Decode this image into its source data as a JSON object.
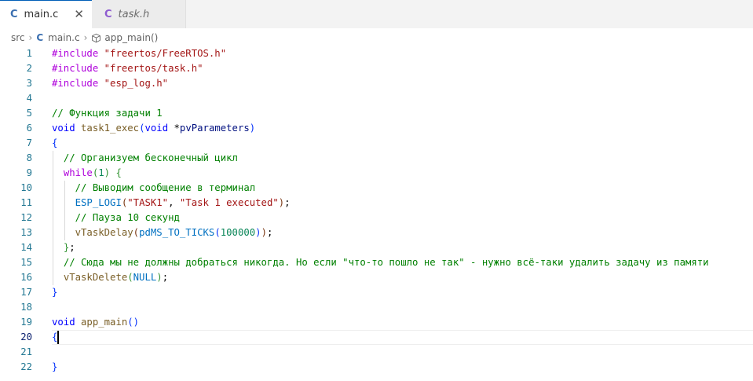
{
  "tabs": [
    {
      "icon": "C",
      "label": "main.c",
      "active": true
    },
    {
      "icon": "C",
      "label": "task.h",
      "active": false
    }
  ],
  "breadcrumb": {
    "folder": "src",
    "file": "main.c",
    "symbol": "app_main()"
  },
  "editor": {
    "current_line": 20,
    "line_numbers": [
      "1",
      "2",
      "3",
      "4",
      "5",
      "6",
      "7",
      "8",
      "9",
      "10",
      "11",
      "12",
      "13",
      "14",
      "15",
      "16",
      "17",
      "18",
      "19",
      "20",
      "21",
      "22"
    ],
    "lines": [
      [
        {
          "t": "#include",
          "c": "pp"
        },
        {
          "t": " ",
          "c": "pl"
        },
        {
          "t": "\"freertos/FreeRTOS.h\"",
          "c": "str"
        }
      ],
      [
        {
          "t": "#include",
          "c": "pp"
        },
        {
          "t": " ",
          "c": "pl"
        },
        {
          "t": "\"freertos/task.h\"",
          "c": "str"
        }
      ],
      [
        {
          "t": "#include",
          "c": "pp"
        },
        {
          "t": " ",
          "c": "pl"
        },
        {
          "t": "\"esp_log.h\"",
          "c": "str"
        }
      ],
      [],
      [
        {
          "t": "// Функция задачи 1",
          "c": "cm"
        }
      ],
      [
        {
          "t": "void",
          "c": "kw"
        },
        {
          "t": " ",
          "c": "pl"
        },
        {
          "t": "task1_exec",
          "c": "fn"
        },
        {
          "t": "(",
          "c": "br1"
        },
        {
          "t": "void",
          "c": "kw"
        },
        {
          "t": " *",
          "c": "pl"
        },
        {
          "t": "pvParameters",
          "c": "id"
        },
        {
          "t": ")",
          "c": "br1"
        }
      ],
      [
        {
          "t": "{",
          "c": "br1"
        }
      ],
      [
        {
          "t": "  ",
          "c": "pl"
        },
        {
          "t": "// Организуем бесконечный цикл",
          "c": "cm"
        }
      ],
      [
        {
          "t": "  ",
          "c": "pl"
        },
        {
          "t": "while",
          "c": "pp"
        },
        {
          "t": "(",
          "c": "br2"
        },
        {
          "t": "1",
          "c": "nm"
        },
        {
          "t": ")",
          "c": "br2"
        },
        {
          "t": " ",
          "c": "pl"
        },
        {
          "t": "{",
          "c": "br2"
        }
      ],
      [
        {
          "t": "    ",
          "c": "pl"
        },
        {
          "t": "// Выводим сообщение в терминал",
          "c": "cm"
        }
      ],
      [
        {
          "t": "    ",
          "c": "pl"
        },
        {
          "t": "ESP_LOGI",
          "c": "mc"
        },
        {
          "t": "(",
          "c": "br3"
        },
        {
          "t": "\"TASK1\"",
          "c": "str"
        },
        {
          "t": ", ",
          "c": "pl"
        },
        {
          "t": "\"Task 1 executed\"",
          "c": "str"
        },
        {
          "t": ")",
          "c": "br3"
        },
        {
          "t": ";",
          "c": "pl"
        }
      ],
      [
        {
          "t": "    ",
          "c": "pl"
        },
        {
          "t": "// Пауза 10 секунд",
          "c": "cm"
        }
      ],
      [
        {
          "t": "    ",
          "c": "pl"
        },
        {
          "t": "vTaskDelay",
          "c": "fn"
        },
        {
          "t": "(",
          "c": "br3"
        },
        {
          "t": "pdMS_TO_TICKS",
          "c": "mc"
        },
        {
          "t": "(",
          "c": "br1"
        },
        {
          "t": "100000",
          "c": "nm"
        },
        {
          "t": ")",
          "c": "br1"
        },
        {
          "t": ")",
          "c": "br3"
        },
        {
          "t": ";",
          "c": "pl"
        }
      ],
      [
        {
          "t": "  ",
          "c": "pl"
        },
        {
          "t": "}",
          "c": "br2"
        },
        {
          "t": ";",
          "c": "pl"
        }
      ],
      [
        {
          "t": "  ",
          "c": "pl"
        },
        {
          "t": "// Сюда мы не должны добраться никогда. Но если \"что-то пошло не так\" - нужно всё-таки удалить задачу из памяти",
          "c": "cm"
        }
      ],
      [
        {
          "t": "  ",
          "c": "pl"
        },
        {
          "t": "vTaskDelete",
          "c": "fn"
        },
        {
          "t": "(",
          "c": "br2"
        },
        {
          "t": "NULL",
          "c": "mc"
        },
        {
          "t": ")",
          "c": "br2"
        },
        {
          "t": ";",
          "c": "pl"
        }
      ],
      [
        {
          "t": "}",
          "c": "br1"
        }
      ],
      [],
      [
        {
          "t": "void",
          "c": "kw"
        },
        {
          "t": " ",
          "c": "pl"
        },
        {
          "t": "app_main",
          "c": "fn"
        },
        {
          "t": "()",
          "c": "br1"
        }
      ],
      [
        {
          "t": "{",
          "c": "br1"
        }
      ],
      [],
      [
        {
          "t": "}",
          "c": "br1"
        }
      ]
    ]
  }
}
